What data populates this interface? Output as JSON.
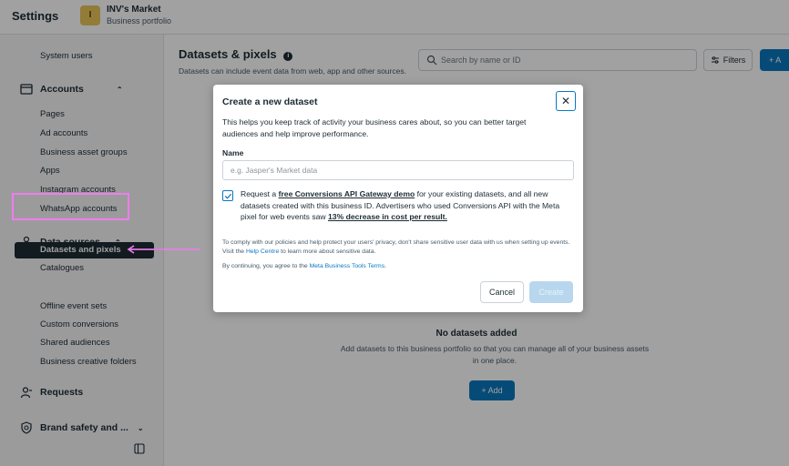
{
  "header": {
    "title": "Settings",
    "logo_letter": "I",
    "business_name": "INV's Market",
    "business_sub": "Business portfolio"
  },
  "sidebar": {
    "system_users": "System users",
    "accounts_section": "Accounts",
    "accounts_items": [
      "Pages",
      "Ad accounts",
      "Business asset groups",
      "Apps",
      "Instagram accounts",
      "WhatsApp accounts"
    ],
    "data_sources_section": "Data sources",
    "data_sources_items": [
      "Catalogues",
      "Datasets and pixels",
      "Offline event sets",
      "Custom conversions",
      "Shared audiences",
      "Business creative folders"
    ],
    "requests_section": "Requests",
    "brand_safety_section": "Brand safety and ..."
  },
  "main": {
    "title": "Datasets & pixels",
    "subtitle": "Datasets can include event data from web, app and other sources.",
    "search_placeholder": "Search by name or ID",
    "filters_label": "Filters",
    "add_top_label": "+ A",
    "empty_title": "No datasets added",
    "empty_text": "Add datasets to this business portfolio so that you can manage all of your business assets in one place.",
    "add_label": "+ Add"
  },
  "modal": {
    "title": "Create a new dataset",
    "description": "This helps you keep track of activity your business cares about, so you can better target audiences and help improve performance.",
    "name_label": "Name",
    "name_placeholder": "e.g. Jasper's Market data",
    "name_value": "",
    "checkbox_checked": true,
    "check_text_1": "Request a ",
    "check_link_1": "free Conversions API Gateway demo",
    "check_text_2": " for your existing datasets, and all new datasets created with this business ID. Advertisers who used Conversions API with the Meta pixel for web events saw ",
    "check_link_2": "13% decrease in cost per result.",
    "policy_text_1": "To comply with our policies and help protect your users' privacy, don't share sensitive user data with us when setting up events. Visit the ",
    "policy_link": "Help Centre",
    "policy_text_2": " to learn more about sensitive data.",
    "agree_text": "By continuing, you agree to the ",
    "agree_link": "Meta Business Tools Terms",
    "agree_end": ".",
    "cancel_label": "Cancel",
    "create_label": "Create"
  },
  "colors": {
    "accent": "#0a78be",
    "annotation": "#f07cf0",
    "active_nav": "#1c2b33"
  }
}
